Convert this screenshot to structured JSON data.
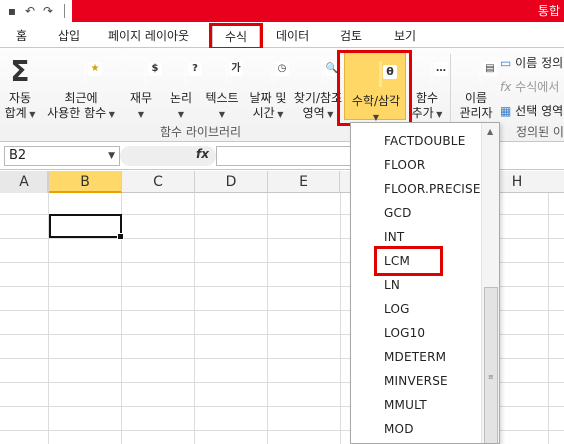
{
  "titlebar": {
    "title": "통합"
  },
  "tabs": [
    {
      "label": "홈"
    },
    {
      "label": "삽입"
    },
    {
      "label": "페이지 레이아웃"
    },
    {
      "label": "수식"
    },
    {
      "label": "데이터"
    },
    {
      "label": "검토"
    },
    {
      "label": "보기"
    }
  ],
  "ribbon": {
    "autosum": {
      "line1": "자동",
      "line2": "합계",
      "icon": "sigma-icon"
    },
    "recent": {
      "line1": "최근에",
      "line2": "사용한 함수"
    },
    "financial": {
      "line1": "재무",
      "glyph": "$"
    },
    "logical": {
      "line1": "논리",
      "glyph": "?"
    },
    "text": {
      "line1": "텍스트",
      "glyph": "가"
    },
    "datetime": {
      "line1": "날짜 및",
      "line2": "시간"
    },
    "lookup": {
      "line1": "찾기/참조",
      "line2": "영역"
    },
    "math": {
      "line1": "수학/삼각",
      "glyph": "θ"
    },
    "more": {
      "line1": "함수",
      "line2": "추가"
    },
    "namemgr": {
      "line1": "이름",
      "line2": "관리자"
    },
    "define_name": "이름 정의",
    "use_in_formula": "수식에서",
    "create_from_selection": "선택 영역",
    "group_library": "함수 라이브러리",
    "group_names": "정의된 이"
  },
  "formula_bar": {
    "namebox": "B2",
    "fx": "fx",
    "value": ""
  },
  "columns": [
    "A",
    "B",
    "C",
    "D",
    "E",
    "H"
  ],
  "selected_column": "B",
  "active_cell": "B2",
  "dropdown": {
    "items": [
      "FACTDOUBLE",
      "FLOOR",
      "FLOOR.PRECISE",
      "GCD",
      "INT",
      "LCM",
      "LN",
      "LOG",
      "LOG10",
      "MDETERM",
      "MINVERSE",
      "MMULT",
      "MOD"
    ],
    "highlighted": "LCM"
  },
  "colors": {
    "titlebar_red": "#e8001c",
    "annotation_red": "#e00000",
    "selected_header": "#ffd86a",
    "math_button": "#ffd766"
  }
}
